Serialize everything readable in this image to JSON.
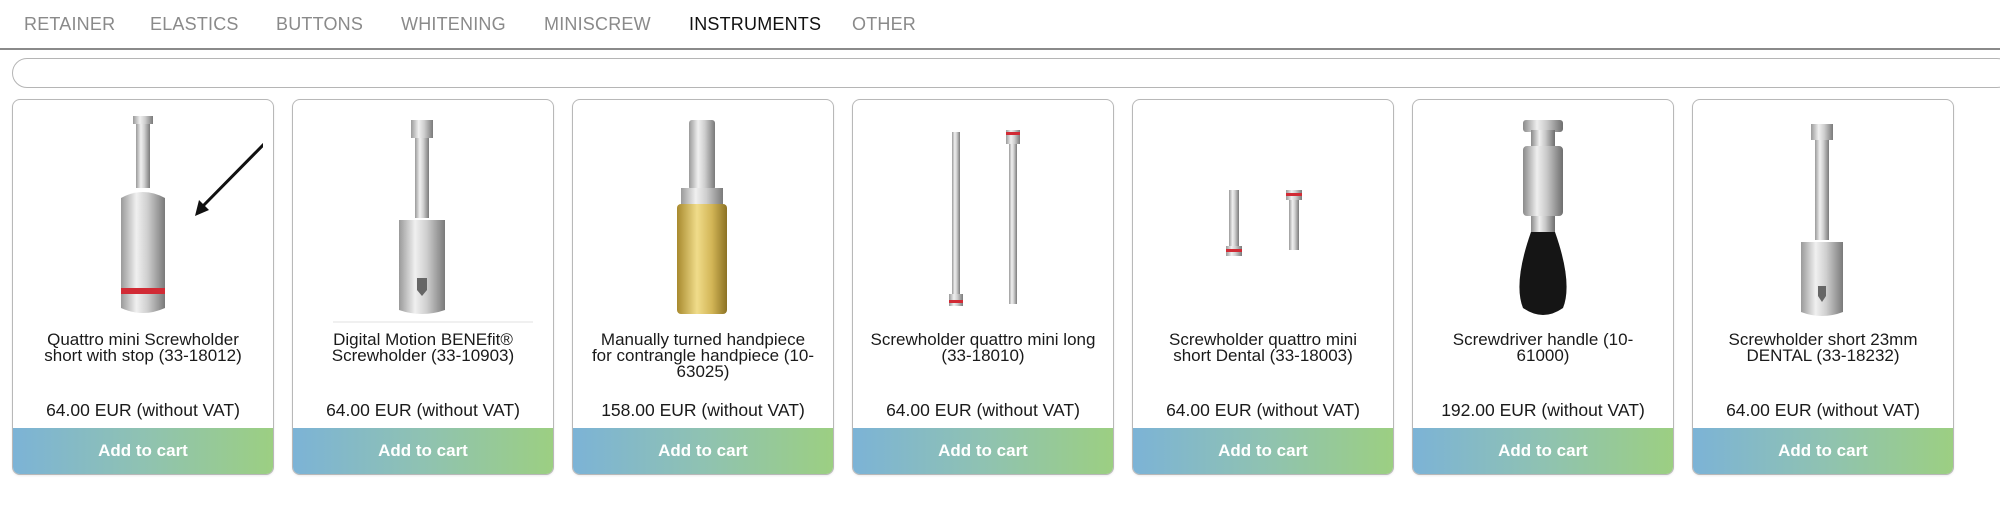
{
  "tabs": [
    {
      "label": "RETAINER",
      "active": false
    },
    {
      "label": "ELASTICS",
      "active": false
    },
    {
      "label": "BUTTONS",
      "active": false
    },
    {
      "label": "WHITENING",
      "active": false
    },
    {
      "label": "MINISCREW",
      "active": false
    },
    {
      "label": "INSTRUMENTS",
      "active": true
    },
    {
      "label": "OTHER",
      "active": false
    }
  ],
  "search": {
    "value": "",
    "placeholder": ""
  },
  "products": [
    {
      "name": "Quattro mini Screwholder short with stop (33-18012)",
      "price": "64.00 EUR (without VAT)",
      "cart": "Add to cart",
      "image": "screwholder-short-stop-icon"
    },
    {
      "name": "Digital Motion BENEfit® Screwholder (33-10903)",
      "price": "64.00 EUR (without VAT)",
      "cart": "Add to cart",
      "image": "screwholder-benefit-icon"
    },
    {
      "name": "Manually turned handpiece for contrangle handpiece (10-63025)",
      "price": "158.00 EUR (without VAT)",
      "cart": "Add to cart",
      "image": "handpiece-gold-icon"
    },
    {
      "name": "Screwholder quattro mini long (33-18010)",
      "price": "64.00 EUR (without VAT)",
      "cart": "Add to cart",
      "image": "screwholder-long-pair-icon"
    },
    {
      "name": "Screwholder quattro mini short Dental (33-18003)",
      "price": "64.00 EUR (without VAT)",
      "cart": "Add to cart",
      "image": "screwholder-short-pair-icon"
    },
    {
      "name": "Screwdriver handle (10-61000)",
      "price": "192.00 EUR (without VAT)",
      "cart": "Add to cart",
      "image": "screwdriver-handle-icon"
    },
    {
      "name": "Screwholder short 23mm DENTAL (33-18232)",
      "price": "64.00 EUR (without VAT)",
      "cart": "Add to cart",
      "image": "screwholder-23mm-icon"
    }
  ]
}
